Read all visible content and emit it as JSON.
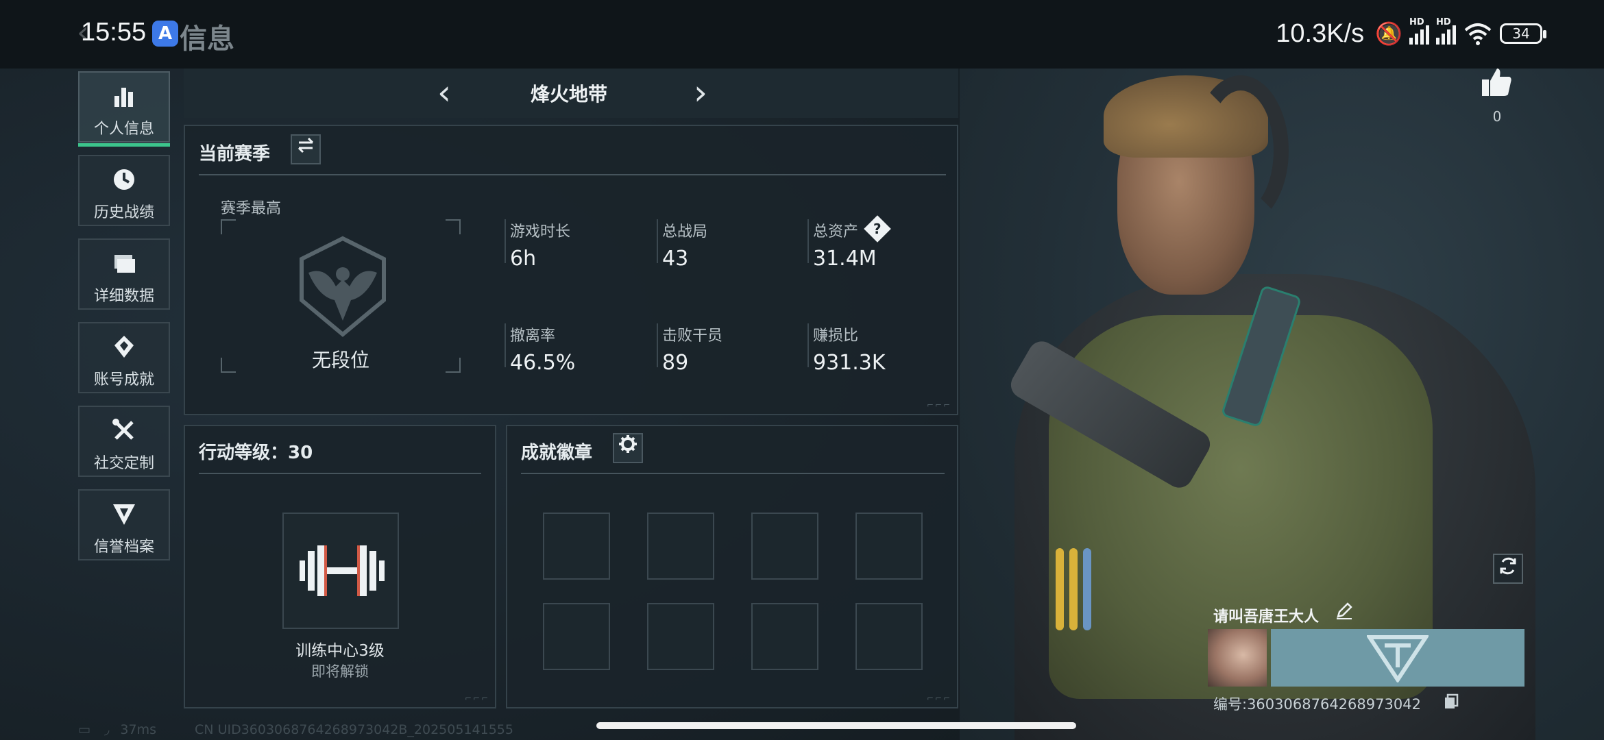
{
  "status_bar": {
    "time": "15:55",
    "app_badge": "A",
    "back_title": "信息",
    "net_speed": "10.3K/s",
    "signal_1_label": "HD",
    "signal_2_label": "HD",
    "battery": "34"
  },
  "sidebar": {
    "items": [
      {
        "label": "个人信息",
        "icon": "bar-chart-icon"
      },
      {
        "label": "历史战绩",
        "icon": "clock-icon"
      },
      {
        "label": "详细数据",
        "icon": "folder-icon"
      },
      {
        "label": "账号成就",
        "icon": "medal-icon"
      },
      {
        "label": "社交定制",
        "icon": "tools-icon"
      },
      {
        "label": "信誉档案",
        "icon": "shield-icon"
      }
    ],
    "active_index": 0
  },
  "mode_tab": {
    "title": "烽火地带"
  },
  "season": {
    "title": "当前赛季",
    "best_label": "赛季最高",
    "rank_text": "无段位",
    "stats": [
      {
        "label": "游戏时长",
        "value": "6h"
      },
      {
        "label": "总战局",
        "value": "43"
      },
      {
        "label": "总资产",
        "value": "31.4M"
      },
      {
        "label": "撤离率",
        "value": "46.5%"
      },
      {
        "label": "击败干员",
        "value": "89"
      },
      {
        "label": "赚损比",
        "value": "931.3K"
      }
    ],
    "help_mark": "?"
  },
  "action_level": {
    "title": "行动等级：30",
    "facility": "训练中心3级",
    "status": "即将解锁"
  },
  "achievements": {
    "title": "成就徽章",
    "slots": 8
  },
  "profile": {
    "likes": "0",
    "name": "请叫吾唐王大人",
    "uid_line": "编号:3603068764268973042"
  },
  "footer": {
    "ping": "37ms",
    "uid_text": "CN UID3603068764268973042B_202505141555"
  },
  "colors": {
    "accent": "#3cc48c",
    "panel_border": "#35434b",
    "background": "#1b262c"
  }
}
